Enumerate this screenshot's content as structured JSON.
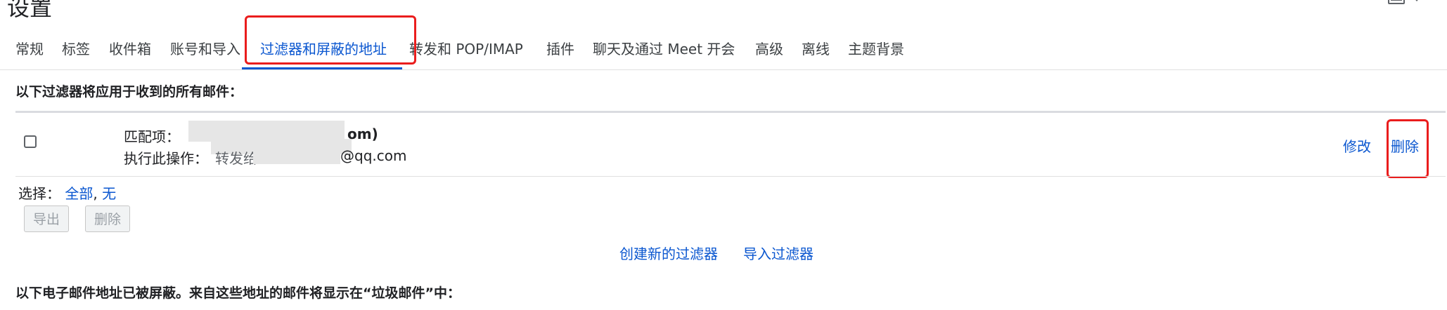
{
  "page": {
    "title": "设置"
  },
  "tabs": [
    {
      "label": "常规",
      "active": false
    },
    {
      "label": "标签",
      "active": false
    },
    {
      "label": "收件箱",
      "active": false
    },
    {
      "label": "账号和导入",
      "active": false
    },
    {
      "label": "过滤器和屏蔽的地址",
      "active": true
    },
    {
      "label": "转发和 POP/IMAP",
      "active": false
    },
    {
      "label": "插件",
      "active": false
    },
    {
      "label": "聊天及通过 Meet 开会",
      "active": false
    },
    {
      "label": "高级",
      "active": false
    },
    {
      "label": "离线",
      "active": false
    },
    {
      "label": "主题背景",
      "active": false
    }
  ],
  "filters_section": {
    "heading": "以下过滤器将应用于收到的所有邮件：",
    "filter": {
      "match_label": "匹配项：",
      "match_value_visible": "om)",
      "action_label": "执行此操作：",
      "action_value_prefix": "转发给",
      "action_value_suffix": "@qq.com",
      "edit_label": "修改",
      "delete_label": "删除"
    },
    "select": {
      "label": "选择：",
      "all": "全部",
      "separator": ",",
      "none": "无"
    },
    "export_button": "导出",
    "delete_button": "删除",
    "create_filter_link": "创建新的过滤器",
    "import_filter_link": "导入过滤器"
  },
  "blocked_section": {
    "heading": "以下电子邮件地址已被屏蔽。来自这些地址的邮件将显示在“垃圾邮件”中："
  },
  "colors": {
    "accent": "#0b57d0",
    "highlight": "#ea1d1d",
    "text": "#202124"
  }
}
